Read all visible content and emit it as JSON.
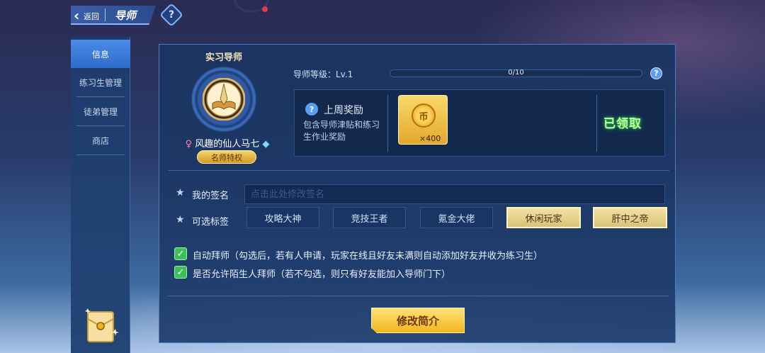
{
  "header": {
    "back_label": "返回",
    "title": "导师",
    "help_symbol": "?"
  },
  "sidebar": {
    "items": [
      {
        "label": "信息",
        "active": true
      },
      {
        "label": "练习生管理",
        "active": false
      },
      {
        "label": "徒弟管理",
        "active": false
      },
      {
        "label": "商店",
        "active": false
      }
    ]
  },
  "mentor": {
    "title": "实习导师",
    "player_name": "风趣的仙人马七",
    "gender_icon": "female-icon",
    "badge": "名师特权"
  },
  "level": {
    "label": "导师等级：Lv.1",
    "progress_text": "0/10",
    "progress_fraction": 0.0
  },
  "reward": {
    "title": "上周奖励",
    "description": "包含导师津贴和练习生作业奖励",
    "coin_symbol": "币",
    "count": "×400",
    "status": "已领取"
  },
  "signature": {
    "label": "我的签名",
    "placeholder": "点击此处修改签名"
  },
  "tags": {
    "label": "可选标签",
    "items": [
      {
        "label": "攻略大神",
        "selected": false
      },
      {
        "label": "竞技王者",
        "selected": false
      },
      {
        "label": "氪金大佬",
        "selected": false
      },
      {
        "label": "休闲玩家",
        "selected": true
      },
      {
        "label": "肝中之帝",
        "selected": true
      }
    ]
  },
  "options": {
    "auto_accept": "自动拜师（勾选后，若有人申请，玩家在线且好友未满则自动添加好友并收为练习生）",
    "allow_strangers": "是否允许陌生人拜师（若不勾选，则只有好友能加入导师门下）"
  },
  "edit_button": "修改简介",
  "colors": {
    "accent_blue": "#4da1ff",
    "gold": "#f2b51c",
    "claimed_green": "#b8ff9a",
    "check_green": "#3fbf5a"
  }
}
